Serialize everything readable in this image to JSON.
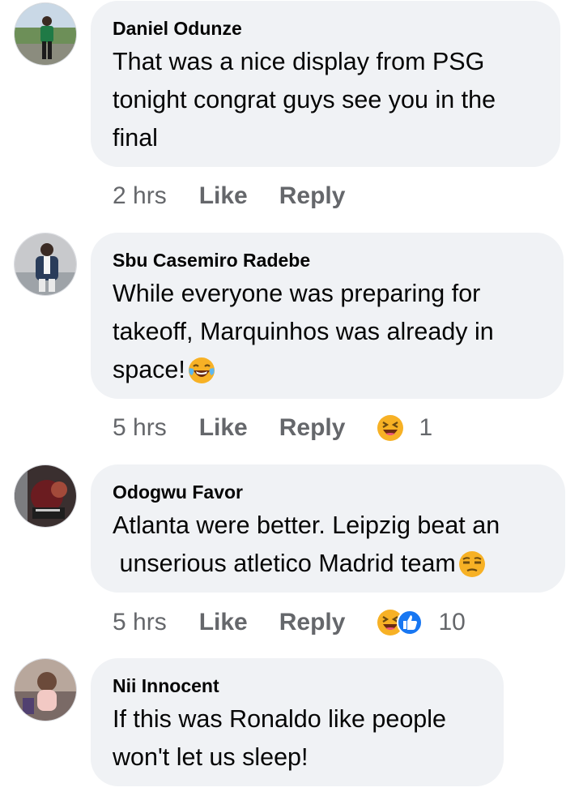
{
  "comments": [
    {
      "author": "Daniel Odunze",
      "text": "That was a nice display from PSG\ntonight congrat guys see you in the\nfinal",
      "time": "2 hrs",
      "like_label": "Like",
      "reply_label": "Reply",
      "avatar_icon": "user-avatar",
      "text_emoji": null,
      "reactions": [],
      "reaction_count": ""
    },
    {
      "author": "Sbu Casemiro Radebe",
      "text": "While everyone was preparing for\ntakeoff, Marquinhos was already in\nspace!",
      "time": "5 hrs",
      "like_label": "Like",
      "reply_label": "Reply",
      "avatar_icon": "user-avatar",
      "text_emoji": "tears-of-joy-emoji",
      "reactions": [
        "haha-reaction-icon"
      ],
      "reaction_count": "1"
    },
    {
      "author": "Odogwu Favor",
      "text": "Atlanta were better. Leipzig beat an\n unserious atletico Madrid team",
      "time": "5 hrs",
      "like_label": "Like",
      "reply_label": "Reply",
      "avatar_icon": "user-avatar",
      "text_emoji": "unamused-face-emoji",
      "reactions": [
        "haha-reaction-icon",
        "like-reaction-icon"
      ],
      "reaction_count": "10"
    },
    {
      "author": "Nii Innocent",
      "text": "If this was Ronaldo like people\nwon't let us sleep!",
      "time": "",
      "like_label": "",
      "reply_label": "",
      "avatar_icon": "user-avatar",
      "text_emoji": null,
      "reactions": [],
      "reaction_count": ""
    }
  ],
  "colors": {
    "bubble_bg": "#f0f2f5",
    "meta_text": "#65676b",
    "like_blue": "#1877f2",
    "emoji_yellow": "#f7b125"
  }
}
